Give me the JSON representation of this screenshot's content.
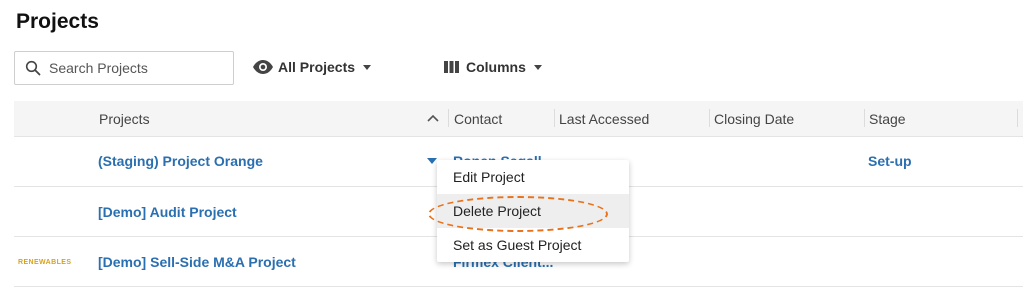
{
  "page": {
    "title": "Projects"
  },
  "search": {
    "placeholder": "Search Projects"
  },
  "filters": {
    "view_label": "All Projects",
    "columns_label": "Columns"
  },
  "table": {
    "headers": {
      "projects": "Projects",
      "contact": "Contact",
      "last_accessed": "Last Accessed",
      "closing_date": "Closing Date",
      "stage": "Stage"
    },
    "rows": [
      {
        "project": "(Staging) Project Orange",
        "contact": "Ronen Segall",
        "stage": "Set-up",
        "logo": ""
      },
      {
        "project": "[Demo] Audit Project",
        "contact": "",
        "stage": "",
        "logo": ""
      },
      {
        "project": "[Demo] Sell-Side M&A Project",
        "contact": "Firmex Client...",
        "stage": "",
        "logo": "RENEWABLES"
      }
    ]
  },
  "context_menu": {
    "items": [
      "Edit Project",
      "Delete Project",
      "Set as Guest Project"
    ],
    "highlighted": "Delete Project"
  },
  "colors": {
    "link": "#2a6fb0",
    "highlight_ring": "#e8731c",
    "logo": "#d8a21a"
  }
}
